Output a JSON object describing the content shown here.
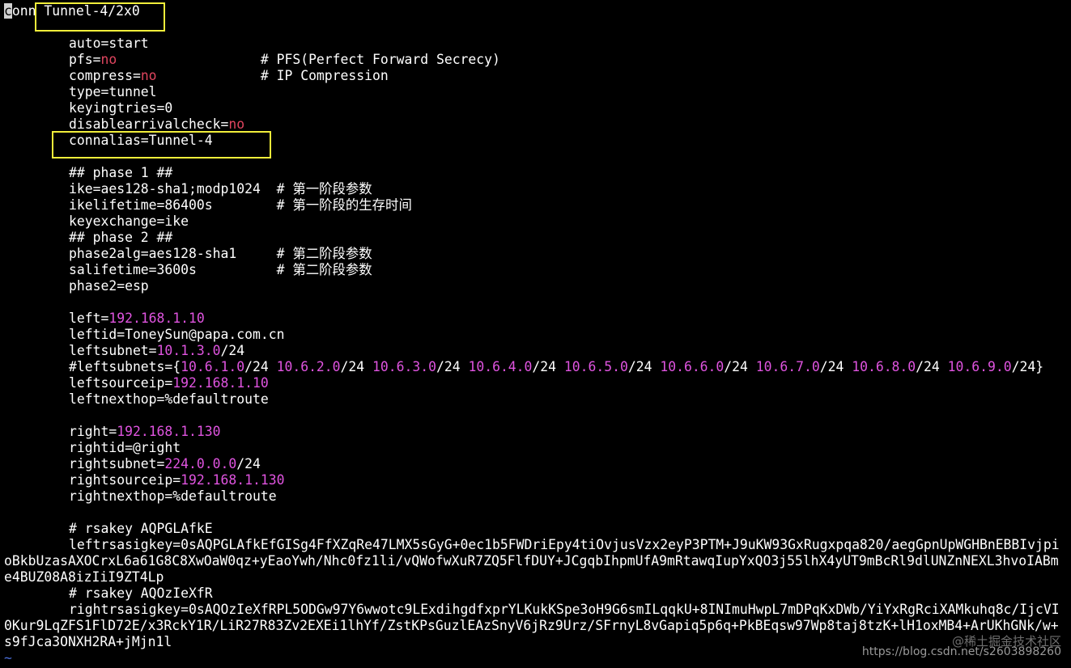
{
  "conn": {
    "keyword_cursor": "c",
    "keyword_rest": "onn",
    "name": "Tunnel-4/2x0"
  },
  "basic": {
    "auto": "auto=start",
    "pfs_key": "pfs=",
    "pfs_val": "no",
    "pfs_comment": "# PFS(Perfect Forward Secrecy)",
    "compress_key": "compress=",
    "compress_val": "no",
    "compress_comment": "# IP Compression",
    "type": "type=tunnel",
    "keyingtries": "keyingtries=0",
    "dac_key": "disablearrivalcheck=",
    "dac_val": "no",
    "connalias": "connalias=Tunnel-4"
  },
  "phase1": {
    "header": "## phase 1 ##",
    "ike": "ike=aes128-sha1;modp1024",
    "ike_comment": "# 第一阶段参数",
    "ikelifetime": "ikelifetime=86400s",
    "ikelifetime_comment": "# 第一阶段的生存时间",
    "keyexchange": "keyexchange=ike"
  },
  "phase2": {
    "header": "## phase 2 ##",
    "phase2alg": "phase2alg=aes128-sha1",
    "phase2alg_comment": "# 第二阶段参数",
    "salifetime": "salifetime=3600s",
    "salifetime_comment": "# 第二阶段参数",
    "phase2": "phase2=esp"
  },
  "left": {
    "left_key": "left=",
    "left_ip": "192.168.1.10",
    "leftid": "leftid=ToneySun@papa.com.cn",
    "leftsubnet_key": "leftsubnet=",
    "leftsubnet_ip": "10.1.3.0",
    "leftsubnet_mask": "/24",
    "leftsubnets_key": "#leftsubnets={",
    "leftsubnets": [
      {
        "ip": "10.6.1.0",
        "mask": "/24 "
      },
      {
        "ip": "10.6.2.0",
        "mask": "/24 "
      },
      {
        "ip": "10.6.3.0",
        "mask": "/24 "
      },
      {
        "ip": "10.6.4.0",
        "mask": "/24 "
      },
      {
        "ip": "10.6.5.0",
        "mask": "/24 "
      },
      {
        "ip": "10.6.6.0",
        "mask": "/24 "
      },
      {
        "ip": "10.6.7.0",
        "mask": "/24 "
      },
      {
        "ip": "10.6.8.0",
        "mask": "/24 "
      },
      {
        "ip": "10.6.9.0",
        "mask": "/24}"
      }
    ],
    "leftsourceip_key": "leftsourceip=",
    "leftsourceip": "192.168.1.10",
    "leftnexthop": "leftnexthop=%defaultroute"
  },
  "right": {
    "right_key": "right=",
    "right_ip": "192.168.1.130",
    "rightid": "rightid=@right",
    "rightsubnet_key": "rightsubnet=",
    "rightsubnet_ip": "224.0.0.0",
    "rightsubnet_mask": "/24",
    "rightsourceip_key": "rightsourceip=",
    "rightsourceip": "192.168.1.130",
    "rightnexthop": "rightnexthop=%defaultroute"
  },
  "keys": {
    "left_comment": "# rsakey AQPGLAfkE",
    "left_line1": "leftrsasigkey=0sAQPGLAfkEfGISg4FfXZqRe47LMX5sGyG+0ec1b5FWDriEpy4tiOvjusVzx2eyP3PTM+J9uKW93GxRugxpqa820/aegGpnUpWGHBnEBBIvjpi",
    "left_line2": "oBkbUzasAXOCrxL6a61G8C8XwOaW0qz+yEaoYwh/Nhc0fz1li/vQWofwXuR7ZQ5FlfDUY+JCgqbIhpmUfA9mRtawqIupYxQO3j55lhX4yUT9mBcRl9dlUNZnNEXL3hvoIABm",
    "left_line3": "e4BUZ08A8izIiI9ZT4Lp",
    "right_comment": "# rsakey AQOzIeXfR",
    "right_line1": "rightrsasigkey=0sAQOzIeXfRPL5ODGw97Y6wwotc9LExdihgdfxprYLKukKSpe3oH9G6smILqqkU+8INImuHwpL7mDPqKxDWb/YiYxRgRciXAMkuhq8c/IjcVI",
    "right_line2": "0Kur9LqZFS1FlD72E/x3RckY1R/LiR27R83Zv2EXEi1lhYf/ZstKPsGuzlEAzSnyV6jRz9Urz/SFrnyL8vGapiq5p6q+PkBEqsw97Wp8taj8tzK+lH1oxMB4+ArUKhGNk/w+",
    "right_line3": "s9fJca3ONXH2RA+jMjn1l"
  },
  "tilde": "~",
  "watermark": {
    "line1": "@稀土掘金技术社区",
    "line2": "https://blog.csdn.net/s2603898260"
  },
  "colors": {
    "background": "#000000",
    "text": "#ffffff",
    "no_value": "#e0455f",
    "ip_value": "#e054e0",
    "highlight_box": "#f1ee3a",
    "tilde": "#4a6dd8"
  }
}
